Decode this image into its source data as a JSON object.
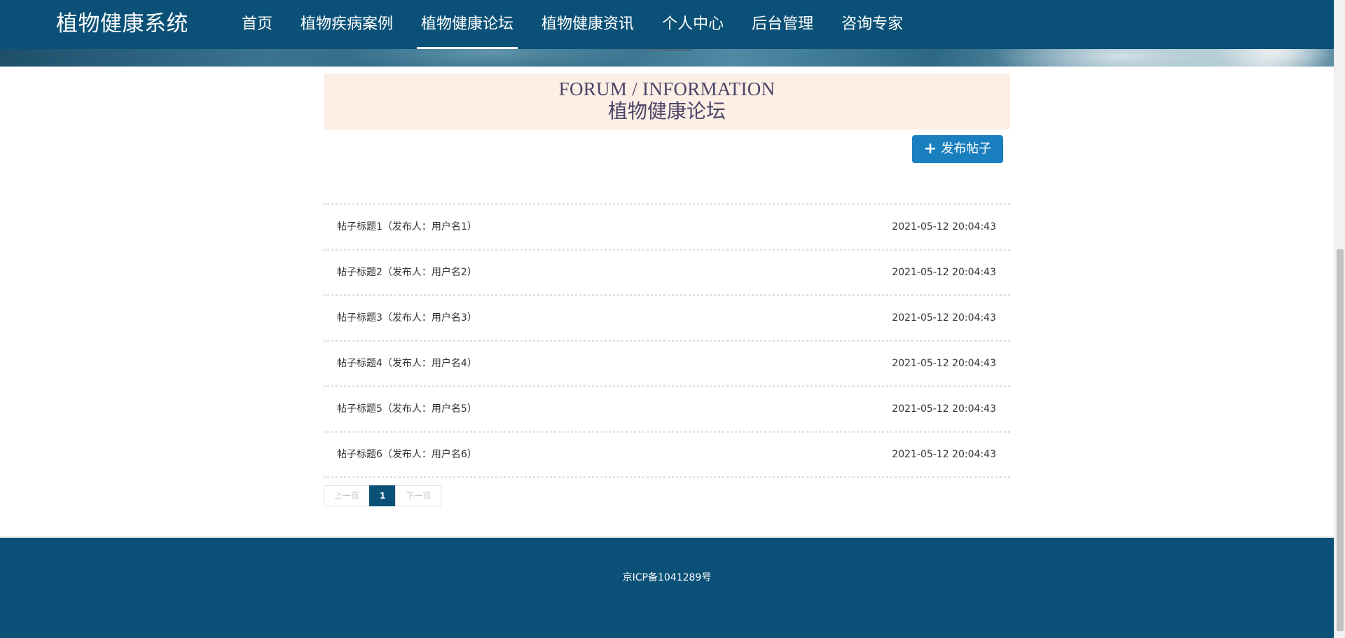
{
  "header": {
    "brand": "植物健康系统",
    "nav": [
      {
        "label": "首页",
        "active": false
      },
      {
        "label": "植物疾病案例",
        "active": false
      },
      {
        "label": "植物健康论坛",
        "active": true
      },
      {
        "label": "植物健康资讯",
        "active": false
      },
      {
        "label": "个人中心",
        "active": false
      },
      {
        "label": "后台管理",
        "active": false
      },
      {
        "label": "咨询专家",
        "active": false
      }
    ]
  },
  "section": {
    "title_en": "FORUM / INFORMATION",
    "title_cn": "植物健康论坛"
  },
  "toolbar": {
    "publish_icon": "plus-icon",
    "publish_label": "发布帖子"
  },
  "posts": [
    {
      "title": "帖子标题1（发布人：用户名1）",
      "time": "2021-05-12 20:04:43"
    },
    {
      "title": "帖子标题2（发布人：用户名2）",
      "time": "2021-05-12 20:04:43"
    },
    {
      "title": "帖子标题3（发布人：用户名3）",
      "time": "2021-05-12 20:04:43"
    },
    {
      "title": "帖子标题4（发布人：用户名4）",
      "time": "2021-05-12 20:04:43"
    },
    {
      "title": "帖子标题5（发布人：用户名5）",
      "time": "2021-05-12 20:04:43"
    },
    {
      "title": "帖子标题6（发布人：用户名6）",
      "time": "2021-05-12 20:04:43"
    }
  ],
  "pagination": {
    "prev": "上一页",
    "current": "1",
    "next": "下一页"
  },
  "footer": {
    "icp": "京ICP备1041289号"
  },
  "colors": {
    "primary": "#0b5177",
    "button": "#1a7fbf",
    "title_bg": "#fdeee6"
  }
}
